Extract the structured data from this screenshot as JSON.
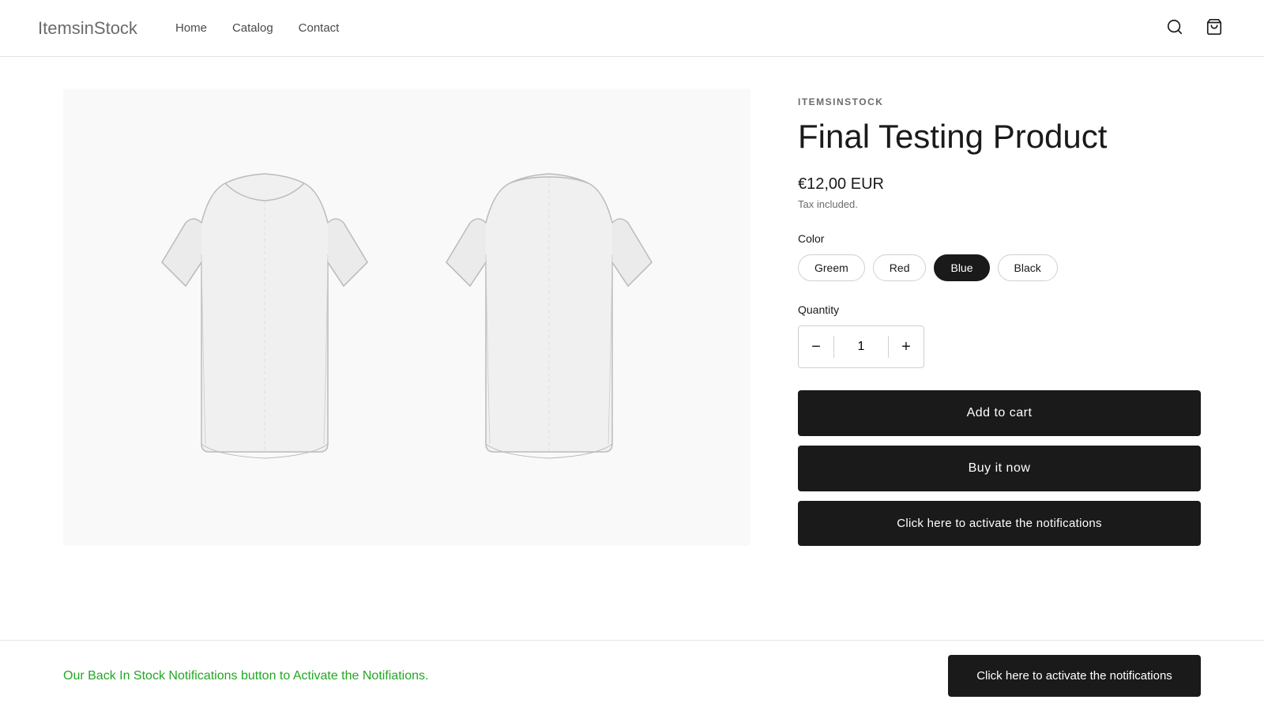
{
  "header": {
    "logo_text": "ItemsinStock",
    "nav": [
      {
        "label": "Home",
        "href": "#"
      },
      {
        "label": "Catalog",
        "href": "#"
      },
      {
        "label": "Contact",
        "href": "#"
      }
    ]
  },
  "product": {
    "brand": "ITEMSINSTOCK",
    "title": "Final Testing Product",
    "price": "€12,00 EUR",
    "tax_note": "Tax included.",
    "color_label": "Color",
    "colors": [
      {
        "label": "Greem",
        "active": false
      },
      {
        "label": "Red",
        "active": false
      },
      {
        "label": "Blue",
        "active": true
      },
      {
        "label": "Black",
        "active": false
      }
    ],
    "quantity_label": "Quantity",
    "quantity_value": "1",
    "add_to_cart_label": "Add to cart",
    "buy_now_label": "Buy it now",
    "notify_label": "Click here to activate the notifications",
    "notification_banner_text": "Our Back In Stock Notifications button to Activate the Notifiations.",
    "qty_decrease": "−",
    "qty_increase": "+"
  }
}
